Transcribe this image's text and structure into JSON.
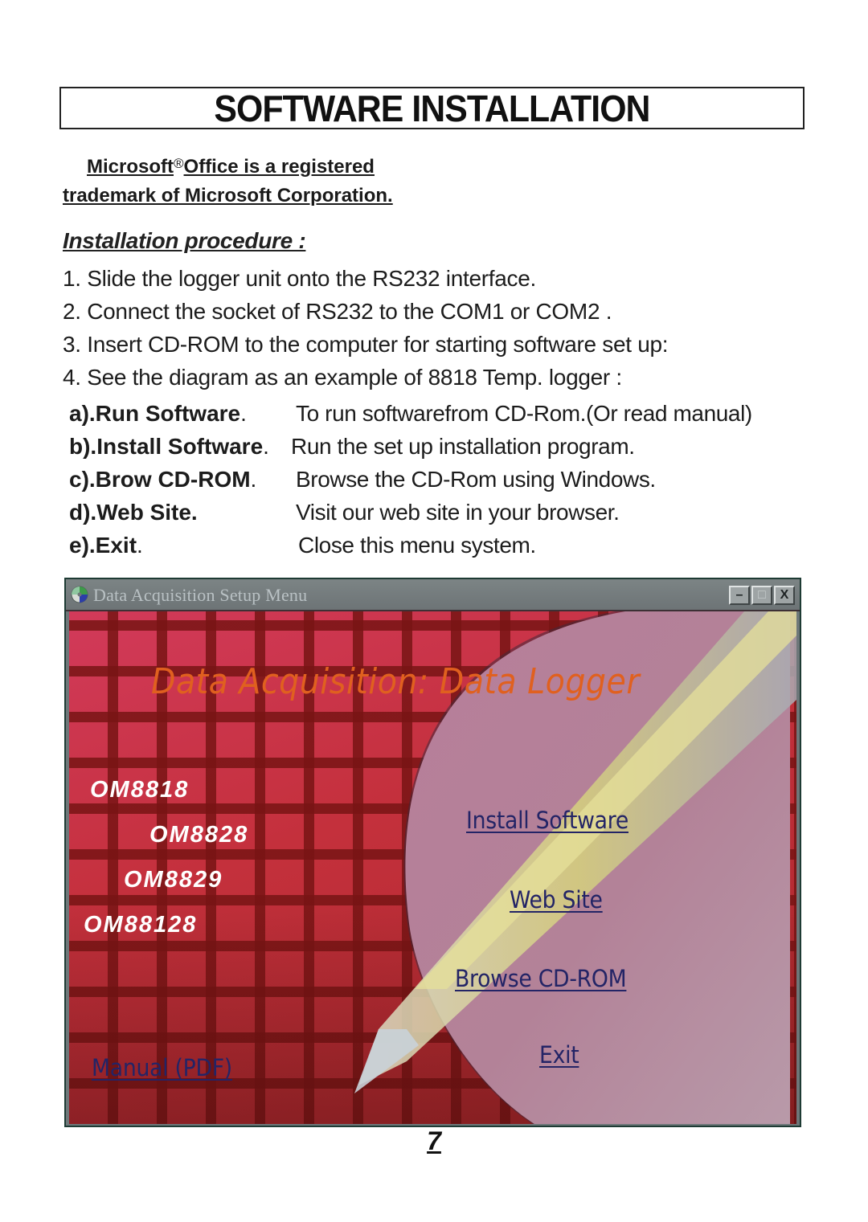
{
  "page": {
    "title": "SOFTWARE INSTALLATION",
    "trademark": {
      "line1_before": "Microsoft",
      "registered_symbol": "®",
      "line1_after": "Office is a registered",
      "line2": "trademark of  Microsoft Corporation."
    },
    "procedure_heading": "Installation procedure :",
    "steps": [
      "1. Slide the logger unit onto the RS232 interface.",
      "2. Connect the socket of RS232 to the COM1 or COM2 .",
      "3. Insert CD-ROM  to the computer for starting software set up:",
      "4. See the diagram as an example of 8818 Temp. logger :"
    ],
    "options": [
      {
        "key": "a).Run Software",
        "dot": ".",
        "desc": "To run softwarefrom CD-Rom.(Or read manual)"
      },
      {
        "key": "b).Install Software",
        "dot": ".",
        "desc": "Run the set up installation program."
      },
      {
        "key": "c).Brow CD-ROM",
        "dot": ".",
        "desc": "Browse the CD-Rom using Windows."
      },
      {
        "key": "d).Web Site.",
        "dot": "",
        "desc": "Visit our web site in your browser."
      },
      {
        "key": "e).Exit",
        "dot": ".",
        "desc": "Close this menu system."
      }
    ],
    "page_number": "7"
  },
  "window": {
    "title": "Data Acquisition Setup Menu",
    "icon": "cd-globe-icon",
    "controls": {
      "minimize": "–",
      "maximize": "□",
      "close": "X"
    },
    "heading": "Data Acquisition: Data Logger",
    "models": [
      "OM8818",
      "OM8828",
      "OM8829",
      "OM88128"
    ],
    "links": {
      "install": "Install Software",
      "web": "Web Site",
      "browse": "Browse CD-ROM",
      "exit": "Exit",
      "manual": "Manual (PDF)"
    },
    "colors": {
      "heading": "#e0601f",
      "link": "#232466",
      "model_text": "#ffffff",
      "red_panel": "#c4303c",
      "mauve_panel": "#b57f98",
      "pencil_yellow": "#d9d27a",
      "titlebar": "#747c7e"
    }
  }
}
